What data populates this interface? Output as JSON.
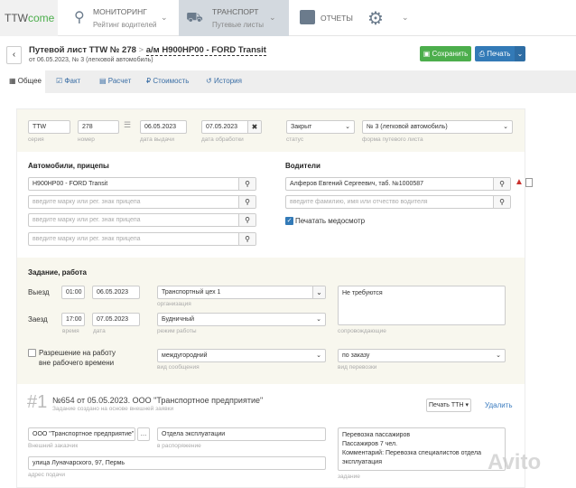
{
  "nav": {
    "logo_a": "TTW",
    "logo_b": "come",
    "monitoring": "МОНИТОРИНГ",
    "monitoring_sub": "Рейтинг водителей",
    "transport": "ТРАНСПОРТ",
    "transport_sub": "Путевые листы",
    "reports": "ОТЧЕТЫ"
  },
  "header": {
    "title": "Путевой лист TTW № 278",
    "sep": ">",
    "vehicle": "а/м Н900НР00 - FORD Transit",
    "subtitle": "от 06.05.2023, № 3 (легковой автомобиль)",
    "save": "Сохранить",
    "print": "Печать",
    "colors": {
      "save": "#4cae4c",
      "print": "#337ab7"
    }
  },
  "tabs": [
    {
      "label": "Общее",
      "icon": "grid-icon"
    },
    {
      "label": "Факт",
      "icon": "check-square-icon"
    },
    {
      "label": "Расчет",
      "icon": "table-icon"
    },
    {
      "label": "Стоимость",
      "icon": "ruble-icon"
    },
    {
      "label": "История",
      "icon": "history-icon"
    }
  ],
  "top": {
    "series": "TTW",
    "series_label": "серия",
    "number": "278",
    "number_label": "номер",
    "issue_date": "06.05.2023",
    "issue_label": "дата выдачи",
    "proc_date": "07.05.2023",
    "proc_label": "дата обработки",
    "status": "Закрыт",
    "status_label": "статус",
    "form": "№ 3 (легковой автомобиль)",
    "form_label": "форма путевого листа"
  },
  "vehicles": {
    "heading": "Автомобили, прицепы",
    "value": "Н900НР00 - FORD Transit",
    "placeholder": "введите марку или рег. знак прицепа"
  },
  "drivers": {
    "heading": "Водители",
    "value": "Алферов Евгений Сергеевич, таб. №1000587",
    "placeholder": "введите фамилию, имя или отчество водителя",
    "medcheck": "Печатать медосмотр"
  },
  "task": {
    "heading": "Задание, работа",
    "out_label": "Выезд",
    "out_time": "01:00",
    "out_date": "06.05.2023",
    "in_label": "Заезд",
    "in_time": "17:00",
    "in_date": "07.05.2023",
    "time_label": "время",
    "date_label": "дата",
    "org": "Транспортный цех 1",
    "org_label": "организация",
    "mode": "Будничный",
    "mode_label": "режим работы",
    "escort": "Не требуются",
    "escort_label": "сопровождающие",
    "permit1": "Разрешение на работу",
    "permit2": "вне рабочего времени",
    "comm": "междугородний",
    "comm_label": "вид сообщения",
    "transport_type": "по заказу",
    "transport_type_label": "вид перевозки"
  },
  "order": {
    "num": "#1",
    "title": "№654 от 05.05.2023. ООО \"Транспортное предприятие\"",
    "subtitle": "Задание создано на основе внешней заявки",
    "print_ttn": "Печать ТТН",
    "delete": "Удалить",
    "customer": "ООО \"Транспортное предприятие\"",
    "customer_label": "Внешний заказчик",
    "dispose": "Отдела эксплуатации",
    "dispose_label": "в распоряжение",
    "address": "улица Луначарского, 97, Пермь",
    "address_label": "адрес подачи",
    "task_lines": [
      "Перевозка пассажиров",
      "Пассажиров 7 чел.",
      "Комментарий: Перевозка специалистов отдела",
      "эксплуатация"
    ],
    "task_label": "задание"
  },
  "watermark": "Avito"
}
